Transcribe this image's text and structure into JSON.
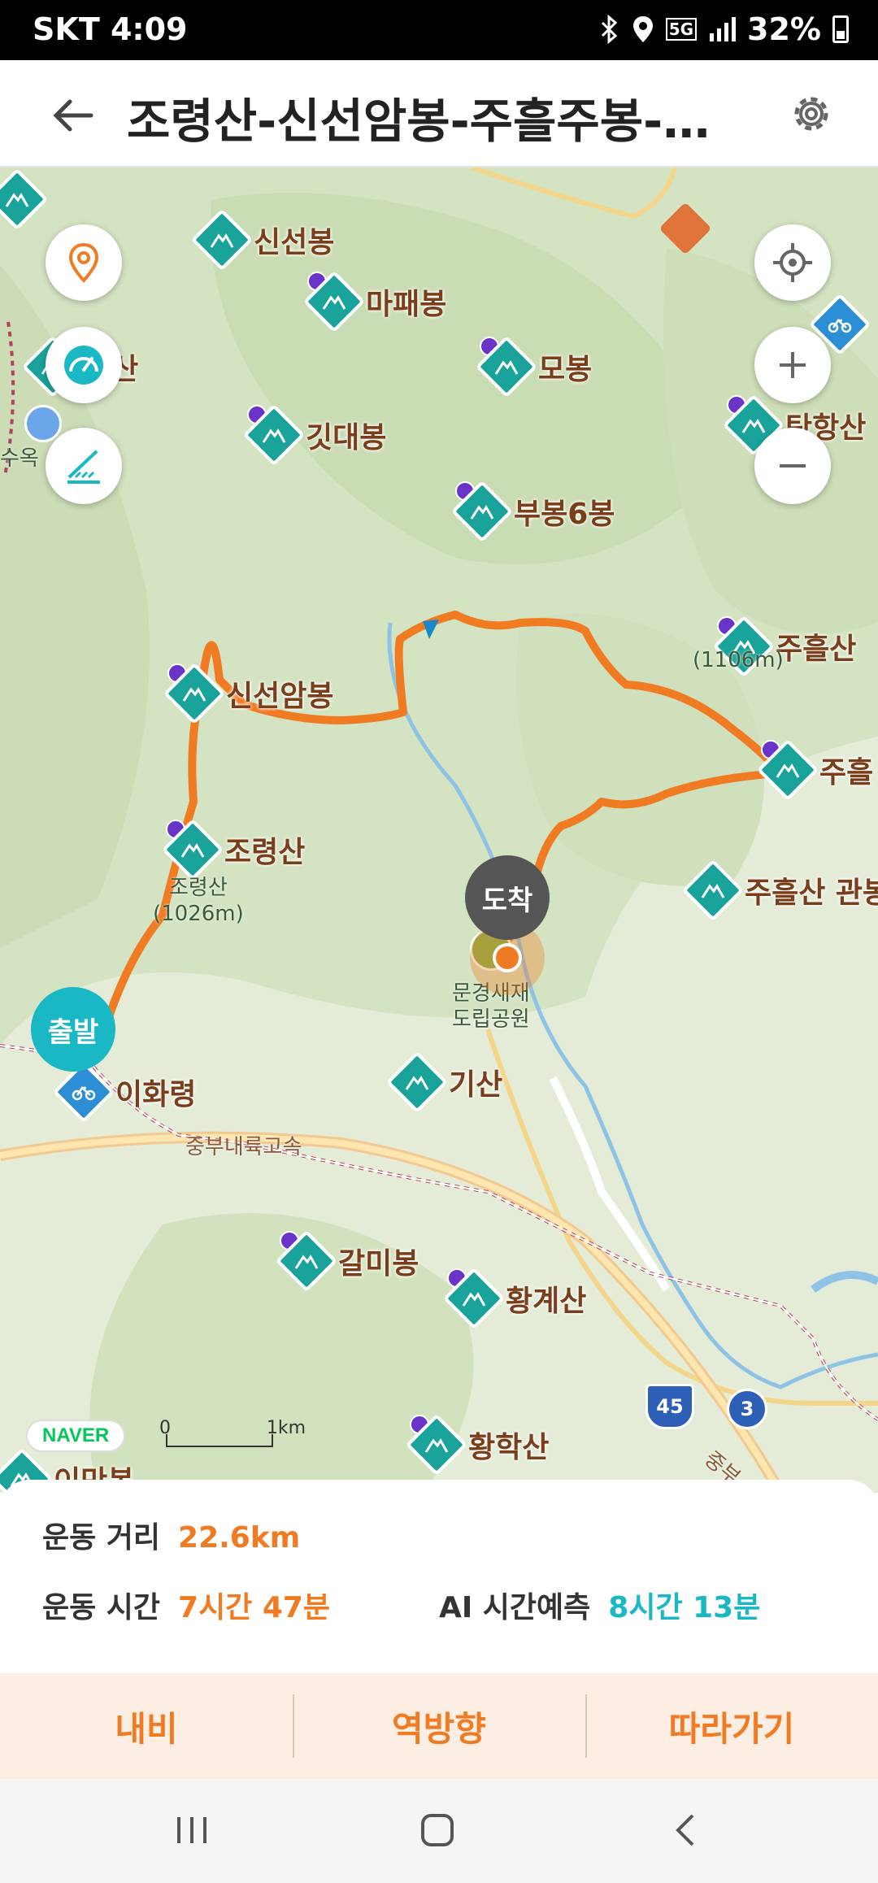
{
  "status": {
    "carrier": "SKT",
    "time": "4:09",
    "network": "5G",
    "battery": "32%"
  },
  "header": {
    "title": "조령산-신선암봉-주흘주봉-문..."
  },
  "map": {
    "pois": [
      {
        "label": "신선봉"
      },
      {
        "label": "마패봉"
      },
      {
        "label": "모봉"
      },
      {
        "label": "깃대봉"
      },
      {
        "label": "부봉6봉"
      },
      {
        "label": "주흘산"
      },
      {
        "label": "신선암봉"
      },
      {
        "label": "조령산"
      },
      {
        "label": "주흘"
      },
      {
        "label": "주흘산 관봉"
      },
      {
        "label": "기산"
      },
      {
        "label": "갈미봉"
      },
      {
        "label": "황계산"
      },
      {
        "label": "황학산"
      },
      {
        "label": "탄항산"
      },
      {
        "label": "이화령"
      }
    ],
    "partial_labels": {
      "left_mountain": "구산",
      "left_place": "수옥",
      "bottom_left": "이만봉"
    },
    "elevation_labels": {
      "joryeong": "조령산\n(1026m)",
      "juheul": "(1106m)"
    },
    "park_label": "문경새재\n도립공원",
    "road_label": "중부내륙고속",
    "road_label_2": "중부",
    "shields": {
      "expressway": "45",
      "national": "3"
    },
    "markers": {
      "start": "출발",
      "arrive": "도착"
    },
    "naver": "NAVER",
    "scale": {
      "zero": "0",
      "unit": "1km"
    }
  },
  "stats": {
    "distance_label": "운동 거리",
    "distance_value": "22.6km",
    "time_label": "운동 시간",
    "time_value": "7시간 47분",
    "ai_label": "AI 시간예측",
    "ai_value": "8시간 13분"
  },
  "actions": {
    "nav": "내비",
    "reverse": "역방향",
    "follow": "따라가기"
  },
  "colors": {
    "route": "#f07b22",
    "teal": "#19a39a",
    "accent_orange": "#f07b22",
    "accent_cyan": "#1ab8c4"
  }
}
